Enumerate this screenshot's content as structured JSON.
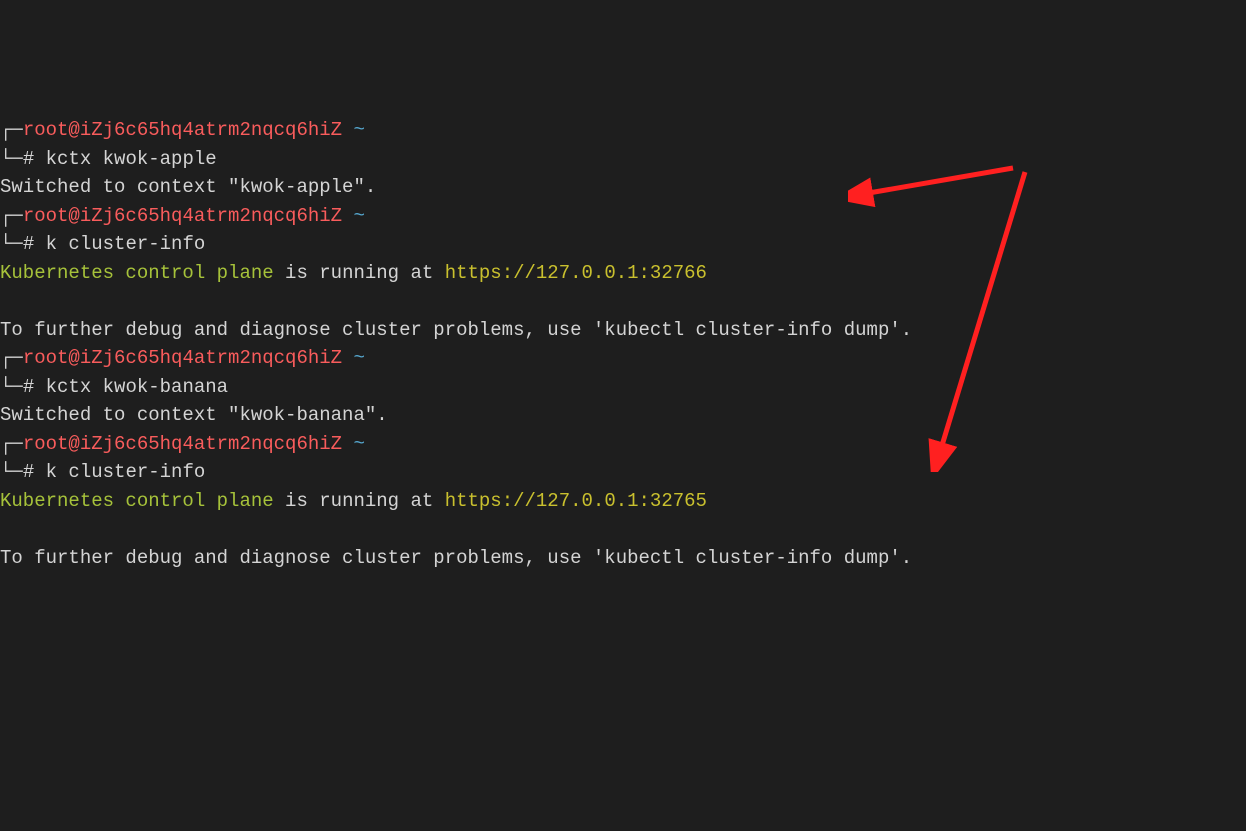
{
  "prompt": {
    "user_host": "root@iZj6c65hq4atrm2nqcq6hiZ",
    "tilde": "~",
    "bracket_top": "┌─",
    "bracket_bottom": "└─",
    "hash": "# "
  },
  "blocks": [
    {
      "command": "kctx kwok-apple",
      "output_line1": "Switched to context \"kwok-apple\"."
    },
    {
      "command": "k cluster-info",
      "info_prefix": "Kubernetes control plane",
      "info_mid": " is running at ",
      "info_url": "https://127.0.0.1:32766",
      "debug_line": "To further debug and diagnose cluster problems, use 'kubectl cluster-info dump'."
    },
    {
      "command": "kctx kwok-banana",
      "output_line1": "Switched to context \"kwok-banana\"."
    },
    {
      "command": "k cluster-info",
      "info_prefix": "Kubernetes control plane",
      "info_mid": " is running at ",
      "info_url": "https://127.0.0.1:32765",
      "debug_line": "To further debug and diagnose cluster problems, use 'kubectl cluster-info dump'."
    }
  ]
}
